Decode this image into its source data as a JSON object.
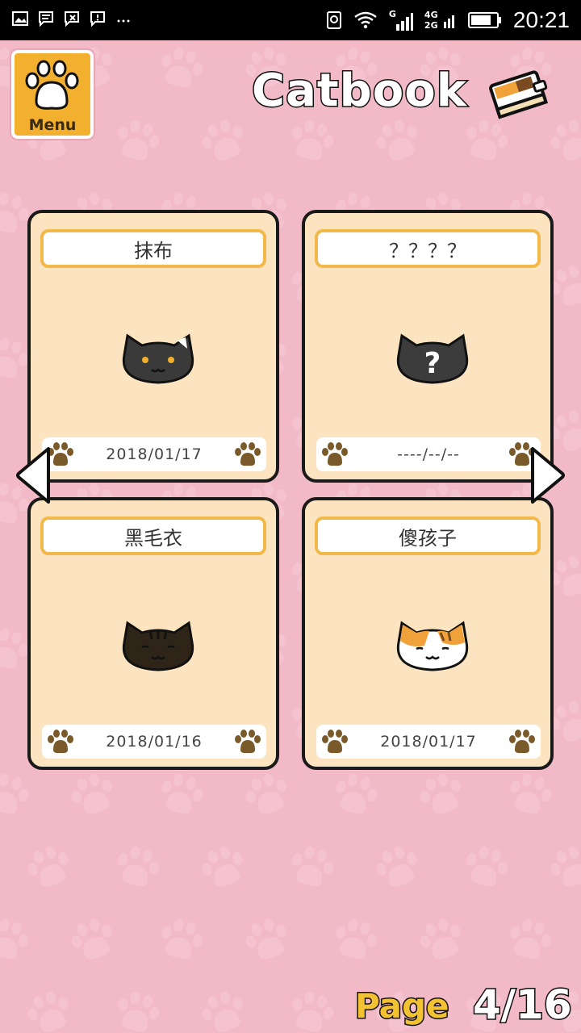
{
  "status_bar": {
    "time": "20:21",
    "network_top": "4G",
    "network_bottom": "2G",
    "signal_tag": "G",
    "icons": [
      "image-icon",
      "message-icon",
      "message-cancel-icon",
      "alert-message-icon",
      "more-icon",
      "lens-icon",
      "wifi-icon",
      "signal-icon",
      "battery-icon"
    ]
  },
  "header": {
    "menu_label": "Menu",
    "title": "Catbook"
  },
  "cards": [
    {
      "name": "抹布",
      "date": "2018/01/17",
      "cat": "black-cat-yellow-eyes"
    },
    {
      "name": "？？？？",
      "date": "----/--/--",
      "cat": "unknown-cat"
    },
    {
      "name": "黑毛衣",
      "date": "2018/01/16",
      "cat": "dark-tabby-cat"
    },
    {
      "name": "傻孩子",
      "date": "2018/01/17",
      "cat": "calico-cat"
    }
  ],
  "pager": {
    "label": "Page",
    "current": "4",
    "total": "16",
    "display": "4/16"
  },
  "colors": {
    "background": "#f2b9c6",
    "card": "#fbe4bf",
    "name_border": "#f3b84a",
    "menu": "#f3b02e",
    "paw": "#7a5a2a"
  }
}
